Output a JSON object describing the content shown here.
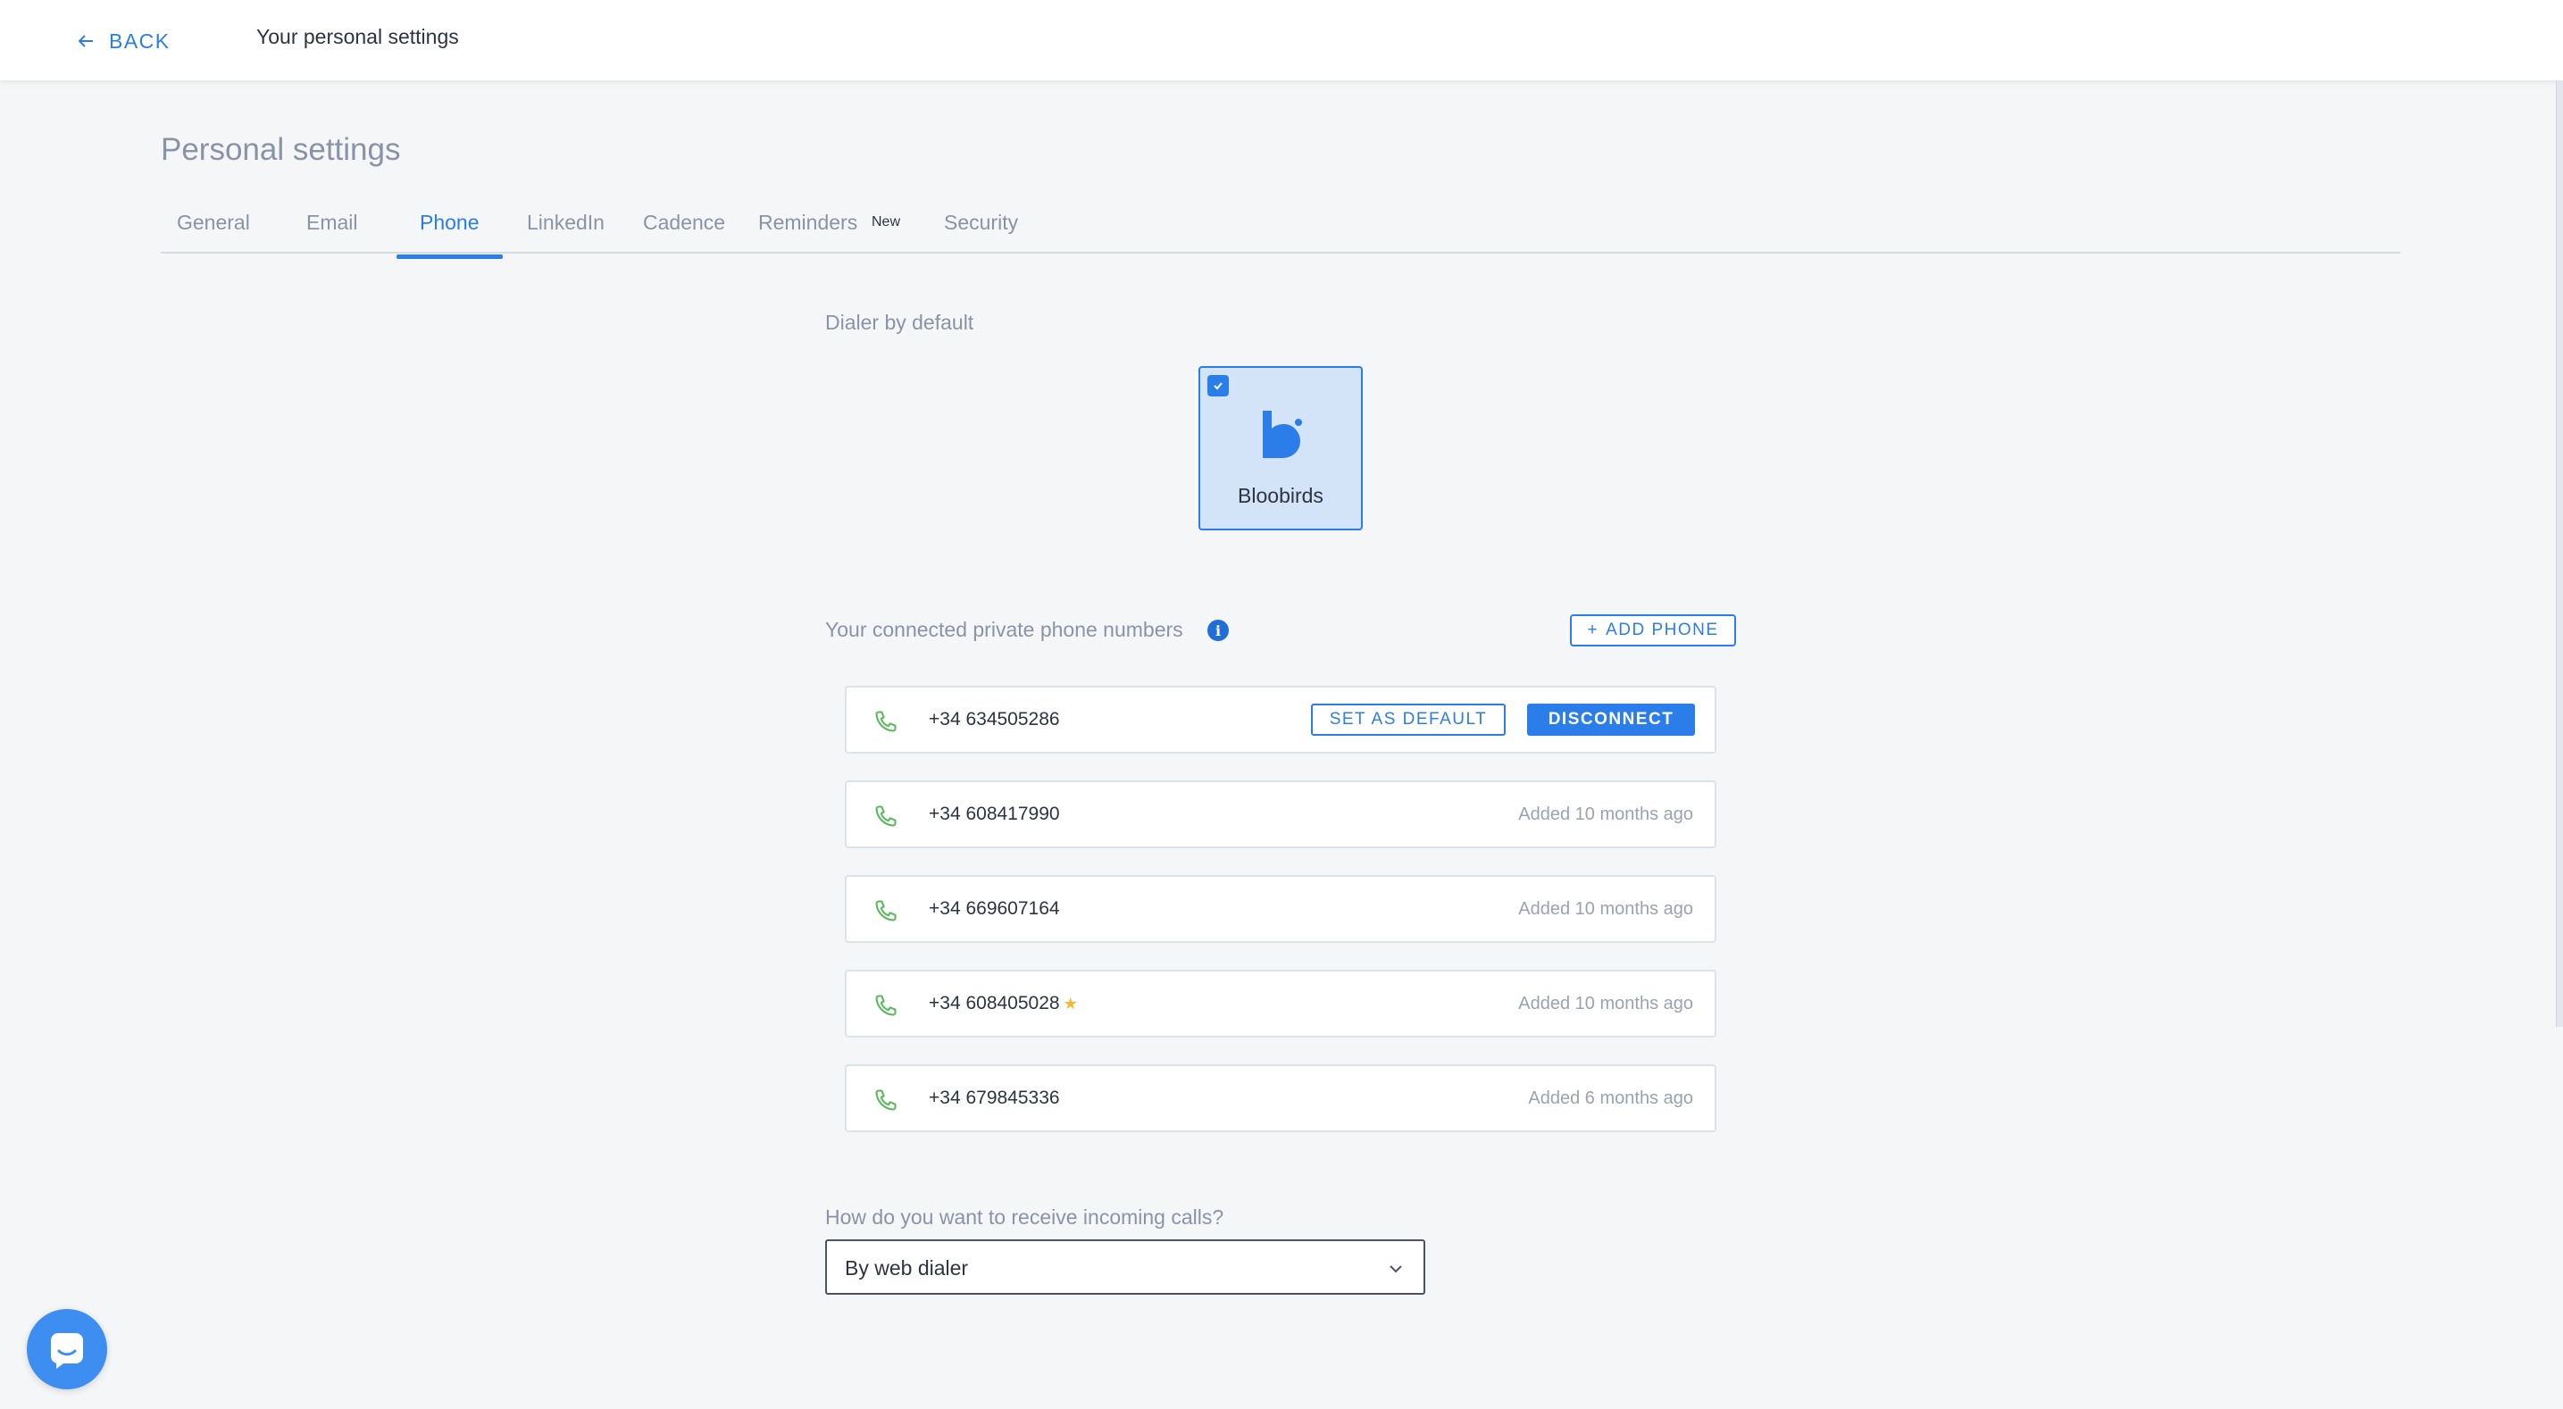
{
  "header": {
    "back_label": "BACK",
    "title": "Your personal settings"
  },
  "page": {
    "title": "Personal settings"
  },
  "tabs": [
    {
      "label": "General",
      "active": false
    },
    {
      "label": "Email",
      "active": false
    },
    {
      "label": "Phone",
      "active": true
    },
    {
      "label": "LinkedIn",
      "active": false
    },
    {
      "label": "Cadence",
      "active": false
    },
    {
      "label": "Reminders",
      "badge": "New",
      "active": false
    },
    {
      "label": "Security",
      "active": false
    }
  ],
  "dialer": {
    "section_label": "Dialer by default",
    "options": [
      {
        "name": "Bloobirds",
        "selected": true,
        "icon": "bloobirds-logo"
      }
    ]
  },
  "phones": {
    "section_label": "Your connected private phone numbers",
    "add_label": "ADD PHONE",
    "set_default_label": "SET AS DEFAULT",
    "disconnect_label": "DISCONNECT",
    "items": [
      {
        "number": "+34 634505286",
        "added": "",
        "hovered": true,
        "default": false
      },
      {
        "number": "+34 608417990",
        "added": "Added 10 months ago",
        "default": false
      },
      {
        "number": "+34 669607164",
        "added": "Added 10 months ago",
        "default": false
      },
      {
        "number": "+34 608405028",
        "added": "Added 10 months ago",
        "default": true
      },
      {
        "number": "+34 679845336",
        "added": "Added 6 months ago",
        "default": false
      }
    ]
  },
  "incoming": {
    "label": "How do you want to receive incoming calls?",
    "selected": "By web dialer"
  },
  "colors": {
    "accent": "#2b7de9",
    "phone_icon": "#5cb85c",
    "star": "#f5b731"
  }
}
